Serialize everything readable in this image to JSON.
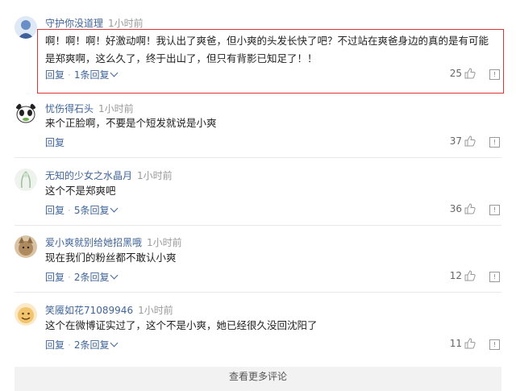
{
  "comments": [
    {
      "username": "守护你没道理",
      "time": "1小时前",
      "text_lines": [
        "啊！啊！啊！好激动啊！我认出了爽爸，但小爽的头发长快了吧？不过站在爽爸身边的真的是有可能",
        "是郑爽啊，这么久了，终于出山了，但只有背影已知足了！！"
      ],
      "reply_label": "回复",
      "replies_label": "1条回复",
      "likes": "25"
    },
    {
      "username": "忧伤得石头",
      "time": "1小时前",
      "text_lines": [
        "来个正脸啊，不要是个短发就说是小爽"
      ],
      "reply_label": "回复",
      "replies_label": "",
      "likes": "37"
    },
    {
      "username": "无知的少女之水晶月",
      "time": "1小时前",
      "text_lines": [
        "这个不是郑爽吧"
      ],
      "reply_label": "回复",
      "replies_label": "5条回复",
      "likes": "36"
    },
    {
      "username": "爱小爽就别给她招黑哦",
      "time": "1小时前",
      "text_lines": [
        "现在我们的粉丝都不敢认小爽"
      ],
      "reply_label": "回复",
      "replies_label": "2条回复",
      "likes": "12"
    },
    {
      "username": "笑魇如花71089946",
      "time": "1小时前",
      "text_lines": [
        "这个在微博证实过了，这个不是小爽，她已经很久没回沈阳了"
      ],
      "reply_label": "回复",
      "replies_label": "2条回复",
      "likes": "11"
    }
  ],
  "more_button": "查看更多评论",
  "colors": {
    "link": "#406599",
    "highlight": "#e03434",
    "time": "#999999"
  },
  "icons": [
    "thumbs-up-icon",
    "report-icon",
    "chevron-down-icon"
  ]
}
